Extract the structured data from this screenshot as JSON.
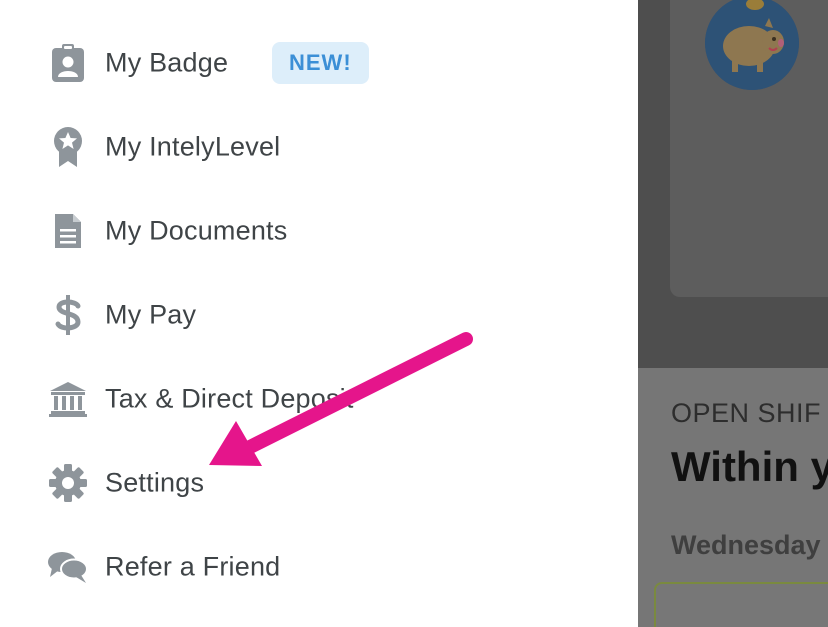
{
  "menu": {
    "items": [
      {
        "label": "My Badge",
        "icon": "badge-icon",
        "badge": "NEW!"
      },
      {
        "label": "My IntelyLevel",
        "icon": "award-ribbon-icon"
      },
      {
        "label": "My Documents",
        "icon": "document-icon"
      },
      {
        "label": "My Pay",
        "icon": "dollar-icon"
      },
      {
        "label": "Tax & Direct Deposit",
        "icon": "bank-icon"
      },
      {
        "label": "Settings",
        "icon": "gear-icon"
      },
      {
        "label": "Refer a Friend",
        "icon": "chat-bubbles-icon"
      }
    ]
  },
  "background": {
    "section_label": "OPEN SHIF",
    "heading": "Within y",
    "day": "Wednesday"
  },
  "colors": {
    "label_text": "#3f4447",
    "icon": "#8e959b",
    "badge_bg": "#ddeefa",
    "badge_text": "#3b8fd6",
    "annotation_arrow": "#e5158b",
    "overlay": "#4e4e4e"
  }
}
